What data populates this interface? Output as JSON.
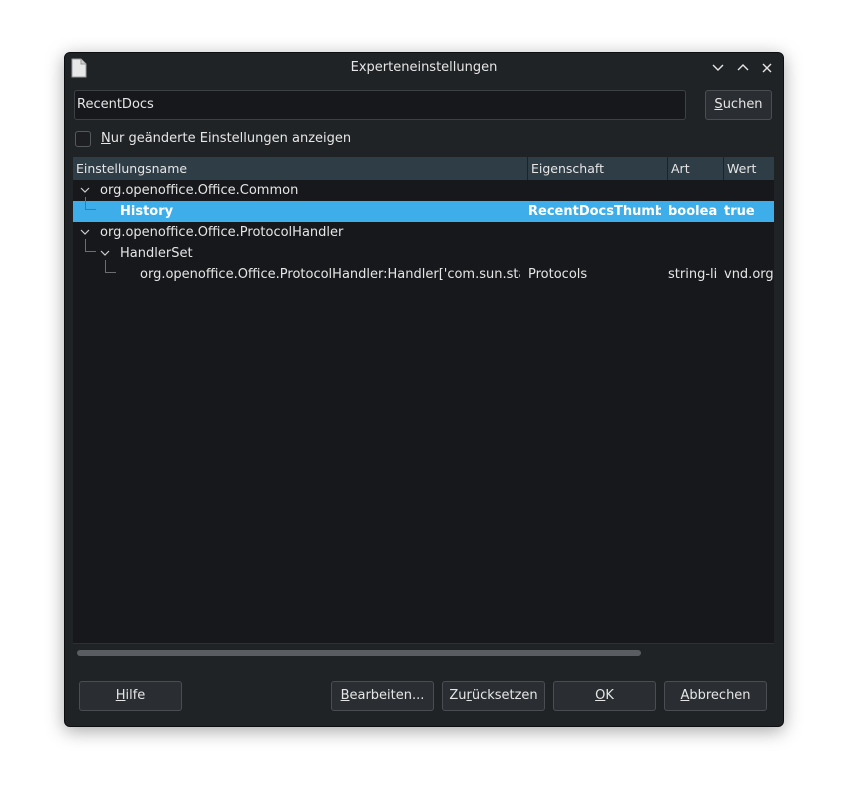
{
  "window": {
    "title": "Experteneinstellungen",
    "controls": [
      "minimize",
      "maximize",
      "close"
    ]
  },
  "search": {
    "value": "RecentDocs",
    "button_label": "Suchen"
  },
  "filter": {
    "checkbox_label": "Nur geänderte Einstellungen anzeigen",
    "checked": false
  },
  "table": {
    "columns": [
      "Einstellungsname",
      "Eigenschaft",
      "Art",
      "Wert"
    ],
    "rows": [
      {
        "name": "org.openoffice.Office.Common",
        "eigenschaft": "",
        "art": "",
        "wert": "",
        "expanded": true
      },
      {
        "name": "History",
        "eigenschaft": "RecentDocsThumbn",
        "art": "booleal",
        "wert": "true",
        "selected": true
      },
      {
        "name": "org.openoffice.Office.ProtocolHandler",
        "eigenschaft": "",
        "art": "",
        "wert": "",
        "expanded": true
      },
      {
        "name": "HandlerSet",
        "eigenschaft": "",
        "art": "",
        "wert": "",
        "expanded": true
      },
      {
        "name": "org.openoffice.Office.ProtocolHandler:Handler['com.sun.star.coi",
        "eigenschaft": "Protocols",
        "art": "string-lis",
        "wert": "vnd.org."
      }
    ]
  },
  "buttons": {
    "help": "Hilfe",
    "edit": "Bearbeiten...",
    "reset": "Zurücksetzen",
    "ok": "OK",
    "cancel": "Abbrechen"
  },
  "colors": {
    "window_bg": "#202326",
    "header_bg": "#2f3d47",
    "selection": "#3daee9"
  }
}
